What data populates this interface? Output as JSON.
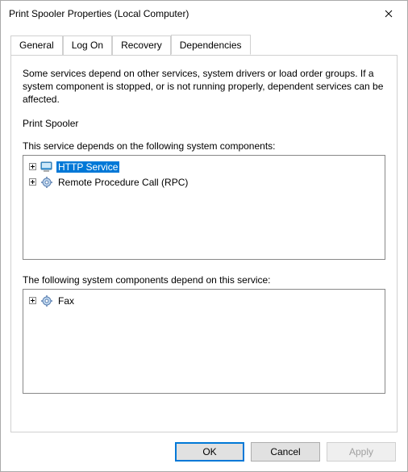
{
  "window": {
    "title": "Print Spooler Properties (Local Computer)"
  },
  "tabs": [
    {
      "label": "General"
    },
    {
      "label": "Log On"
    },
    {
      "label": "Recovery"
    },
    {
      "label": "Dependencies"
    }
  ],
  "description": "Some services depend on other services, system drivers or load order groups. If a system component is stopped, or is not running properly, dependent services can be affected.",
  "serviceName": "Print Spooler",
  "dependsOn": {
    "label": "This service depends on the following system components:",
    "items": [
      {
        "label": "HTTP Service",
        "icon": "computer",
        "expandable": true,
        "selected": true
      },
      {
        "label": "Remote Procedure Call (RPC)",
        "icon": "gear",
        "expandable": true,
        "selected": false
      }
    ]
  },
  "dependents": {
    "label": "The following system components depend on this service:",
    "items": [
      {
        "label": "Fax",
        "icon": "gear",
        "expandable": true,
        "selected": false
      }
    ]
  },
  "buttons": {
    "ok": "OK",
    "cancel": "Cancel",
    "apply": "Apply"
  }
}
